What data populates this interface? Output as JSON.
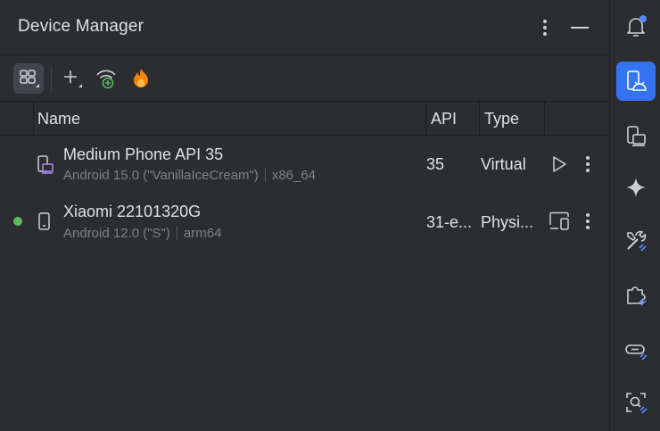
{
  "panel": {
    "title": "Device Manager"
  },
  "icons": {
    "more": "more-vertical-icon",
    "minimize": "minimize-icon",
    "grid": "grid-view-icon",
    "add": "add-icon",
    "wifi": "pair-wifi-icon",
    "firebase": "firebase-icon"
  },
  "table": {
    "columns": [
      "Name",
      "API",
      "Type"
    ],
    "rows": [
      {
        "name": "Medium Phone API 35",
        "os": "Android 15.0 (\"VanillaIceCream\")",
        "abi": "x86_64",
        "api": "35",
        "type": "Virtual",
        "online": false
      },
      {
        "name": "Xiaomi 22101320G",
        "os": "Android 12.0 (\"S\")",
        "abi": "arm64",
        "api": "31-e...",
        "type": "Physi...",
        "online": true
      }
    ]
  },
  "colors": {
    "accent": "#3574f0",
    "online": "#5fb85c",
    "background": "#2b2d30",
    "firebase": "#f5820d"
  }
}
